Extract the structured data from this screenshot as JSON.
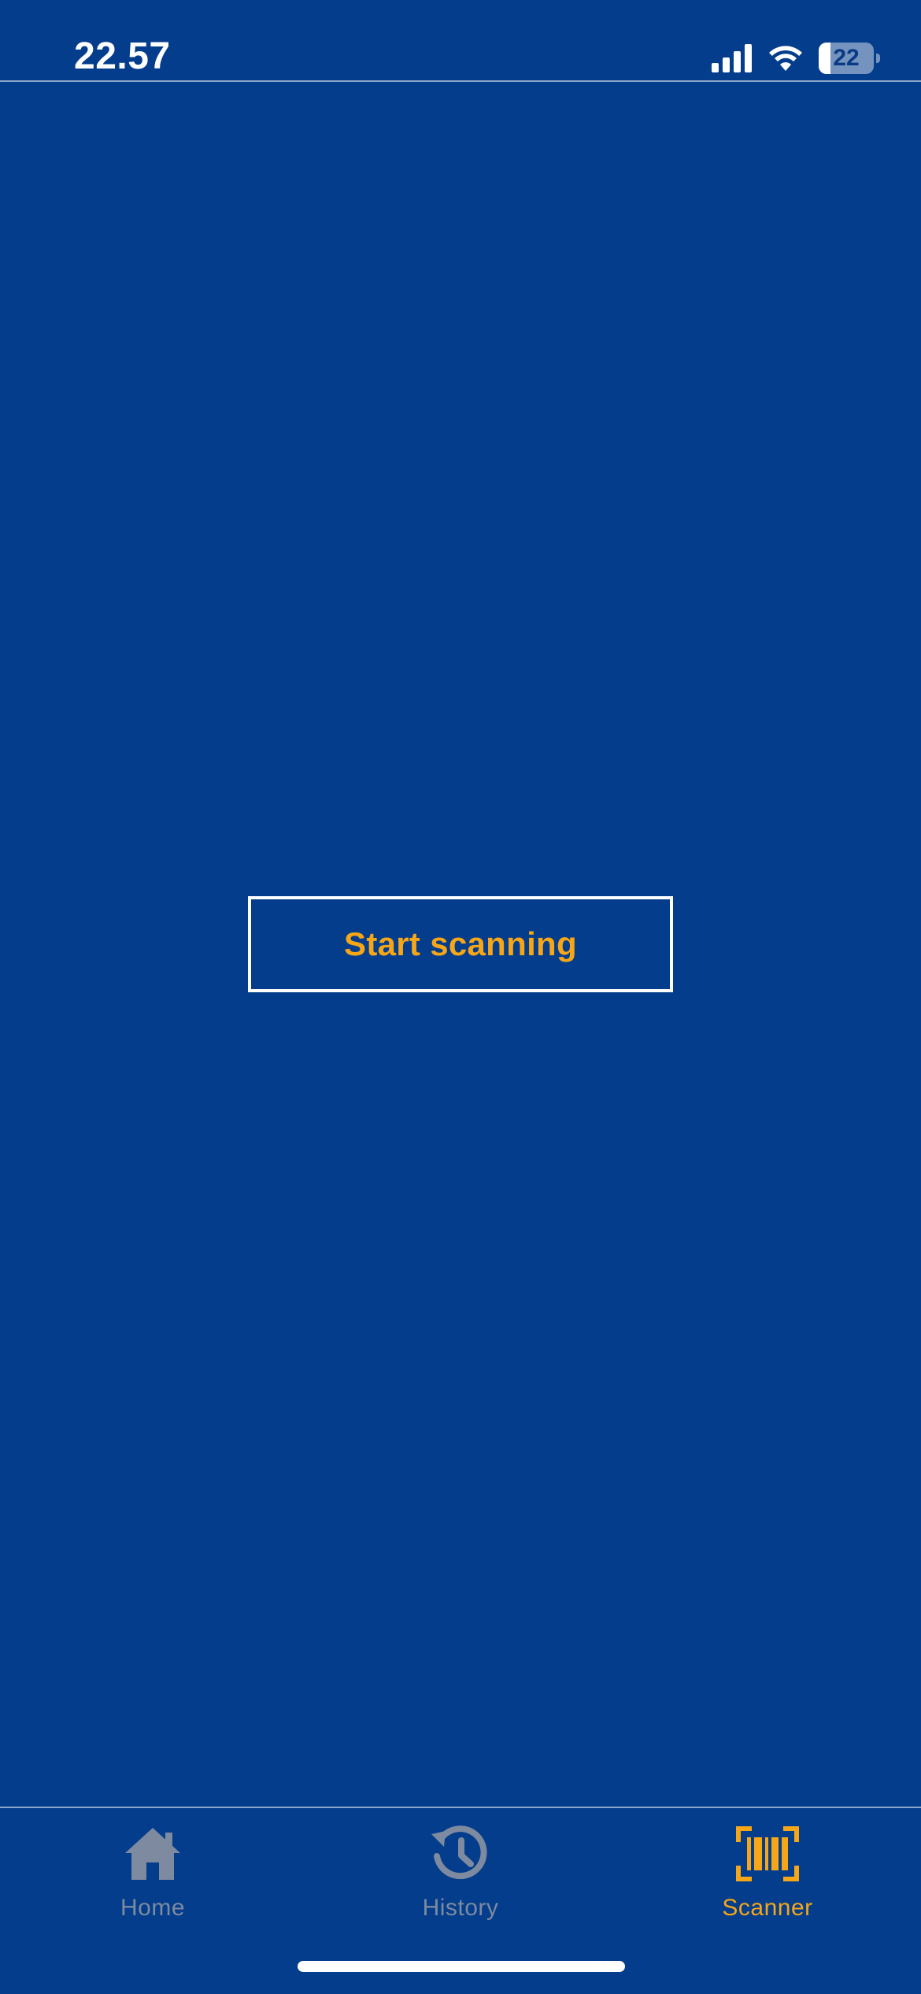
{
  "status_bar": {
    "time": "22.57",
    "battery_level": "22",
    "battery_fraction": 0.22,
    "icons": [
      "signal-icon",
      "wifi-icon",
      "battery-icon"
    ]
  },
  "main": {
    "scan_button_label": "Start scanning"
  },
  "tab_bar": {
    "items": [
      {
        "label": "Home",
        "icon": "home-icon",
        "active": false
      },
      {
        "label": "History",
        "icon": "history-icon",
        "active": false
      },
      {
        "label": "Scanner",
        "icon": "barcode-scanner-icon",
        "active": true
      }
    ]
  },
  "colors": {
    "background": "#033d8b",
    "accent": "#f6a617",
    "inactive": "#7d8aa0",
    "foreground": "#ffffff"
  }
}
